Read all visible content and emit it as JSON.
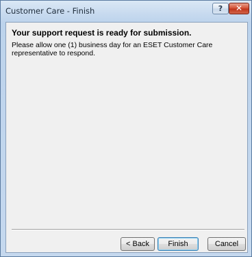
{
  "window": {
    "title": "Customer Care - Finish",
    "help_glyph": "?",
    "close_glyph": "✕"
  },
  "content": {
    "heading": "Your support request is ready for submission.",
    "message": "Please allow one (1) business day for an ESET Customer Care representative to respond."
  },
  "buttons": {
    "back": "< Back",
    "finish": "Finish",
    "cancel": "Cancel"
  },
  "colors": {
    "title_bar": "#c7daef",
    "client_bg": "#f0f0f0",
    "close_button": "#c0351c"
  }
}
